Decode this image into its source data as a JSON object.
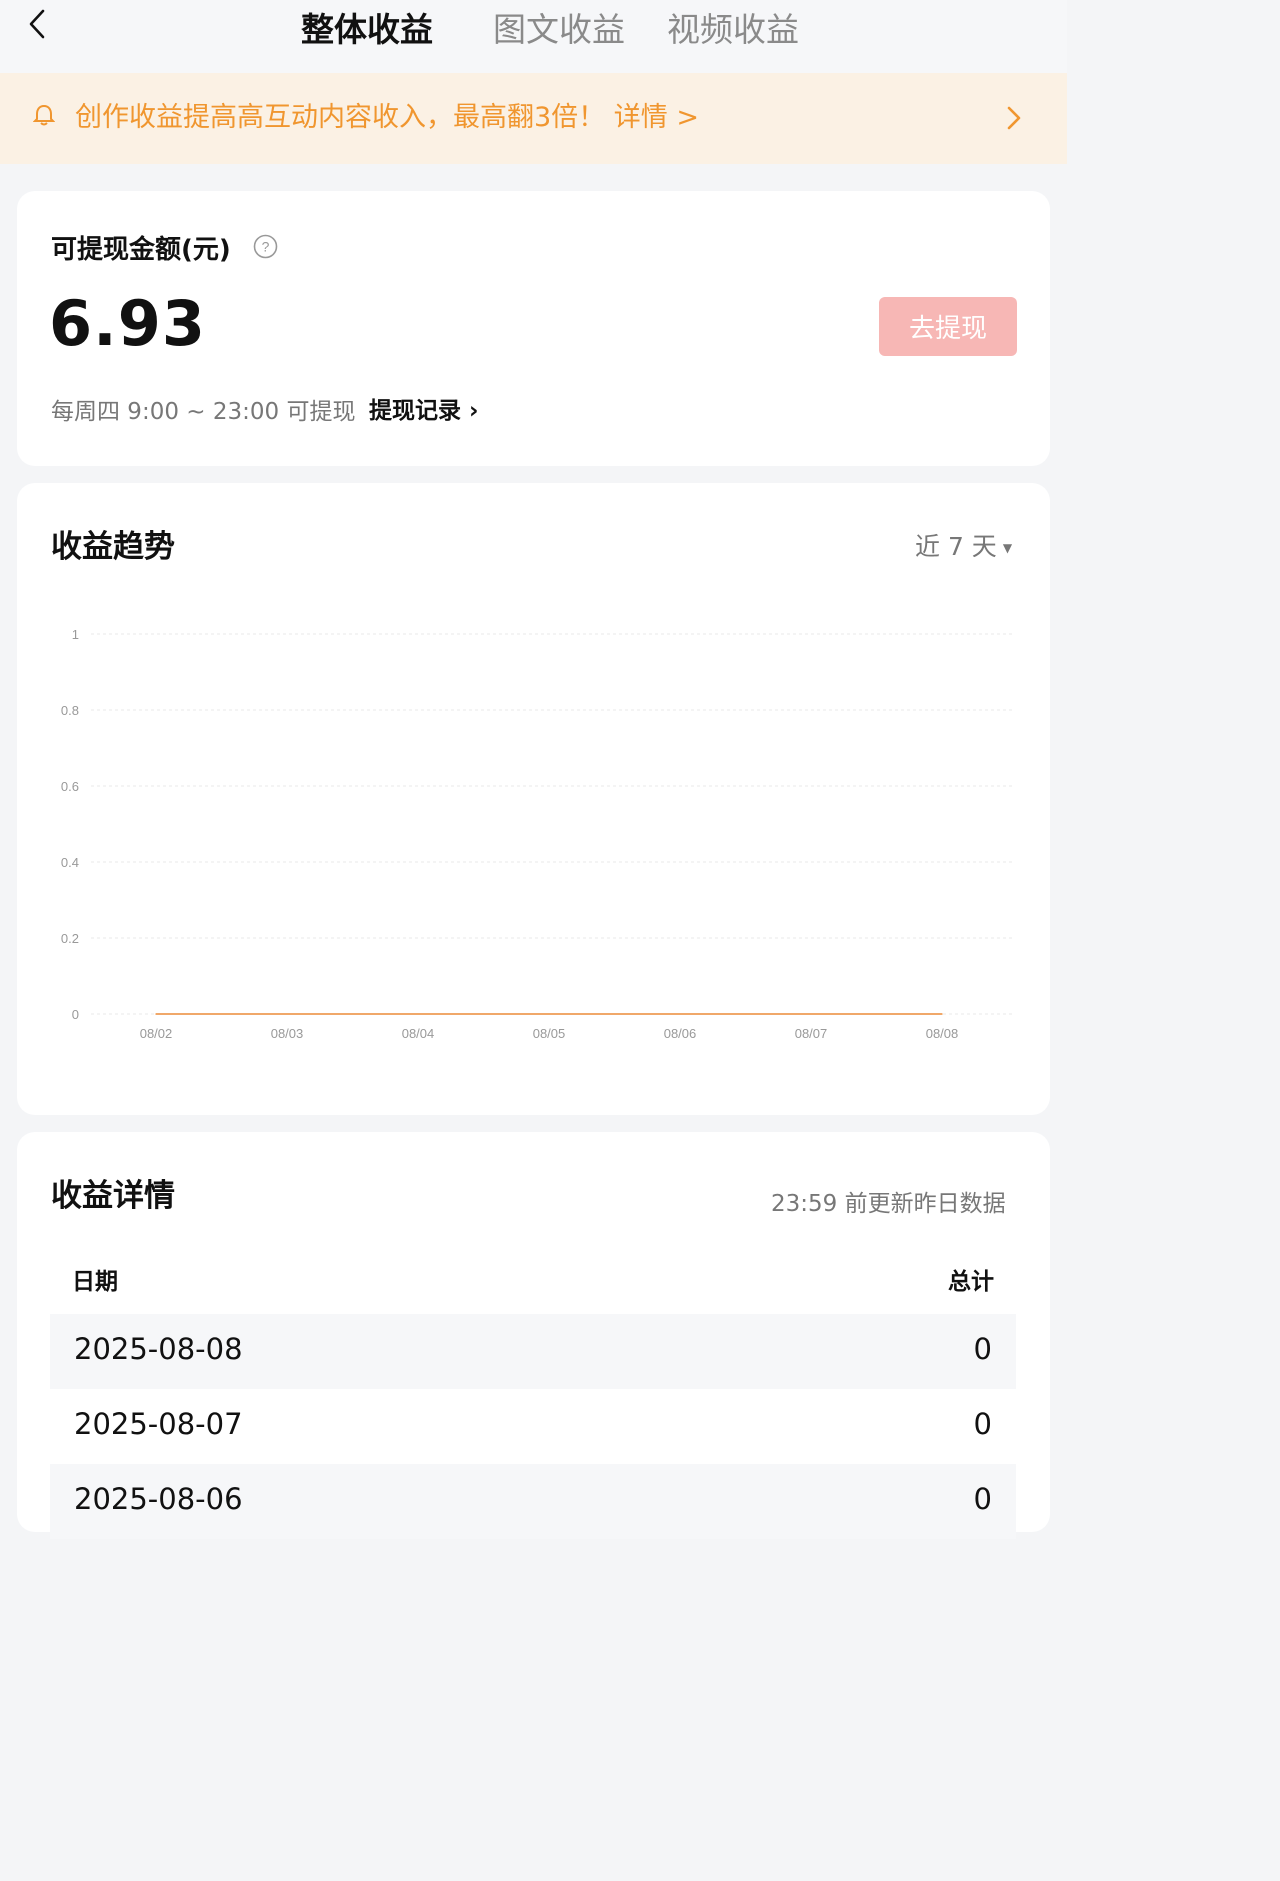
{
  "header": {
    "tabs": [
      {
        "label": "整体收益",
        "active": true
      },
      {
        "label": "图文收益",
        "active": false
      },
      {
        "label": "视频收益",
        "active": false
      }
    ]
  },
  "banner": {
    "text": "创作收益提高高互动内容收入，最高翻3倍！ 详情 >"
  },
  "balance": {
    "label": "可提现金额(元)",
    "value": "6.93",
    "withdraw_button": "去提现",
    "schedule": "每周四 9:00 ~ 23:00 可提现",
    "record_link": "提现记录 ›"
  },
  "trend": {
    "title": "收益趋势",
    "range": "近 7 天"
  },
  "chart_data": {
    "type": "line",
    "x": [
      "08/02",
      "08/03",
      "08/04",
      "08/05",
      "08/06",
      "08/07",
      "08/08"
    ],
    "series": [
      {
        "values": [
          0,
          0,
          0,
          0,
          0,
          0,
          0
        ]
      }
    ],
    "yticks": [
      "0",
      "0.2",
      "0.4",
      "0.6",
      "0.8",
      "1"
    ],
    "ylim": [
      0,
      1
    ],
    "grid": true,
    "line_color": "#f0a86a"
  },
  "details": {
    "title": "收益详情",
    "update_note": "23:59 前更新昨日数据",
    "columns": [
      "日期",
      "总计"
    ],
    "rows": [
      {
        "date": "2025-08-08",
        "total": "0"
      },
      {
        "date": "2025-08-07",
        "total": "0"
      },
      {
        "date": "2025-08-06",
        "total": "0"
      }
    ]
  }
}
